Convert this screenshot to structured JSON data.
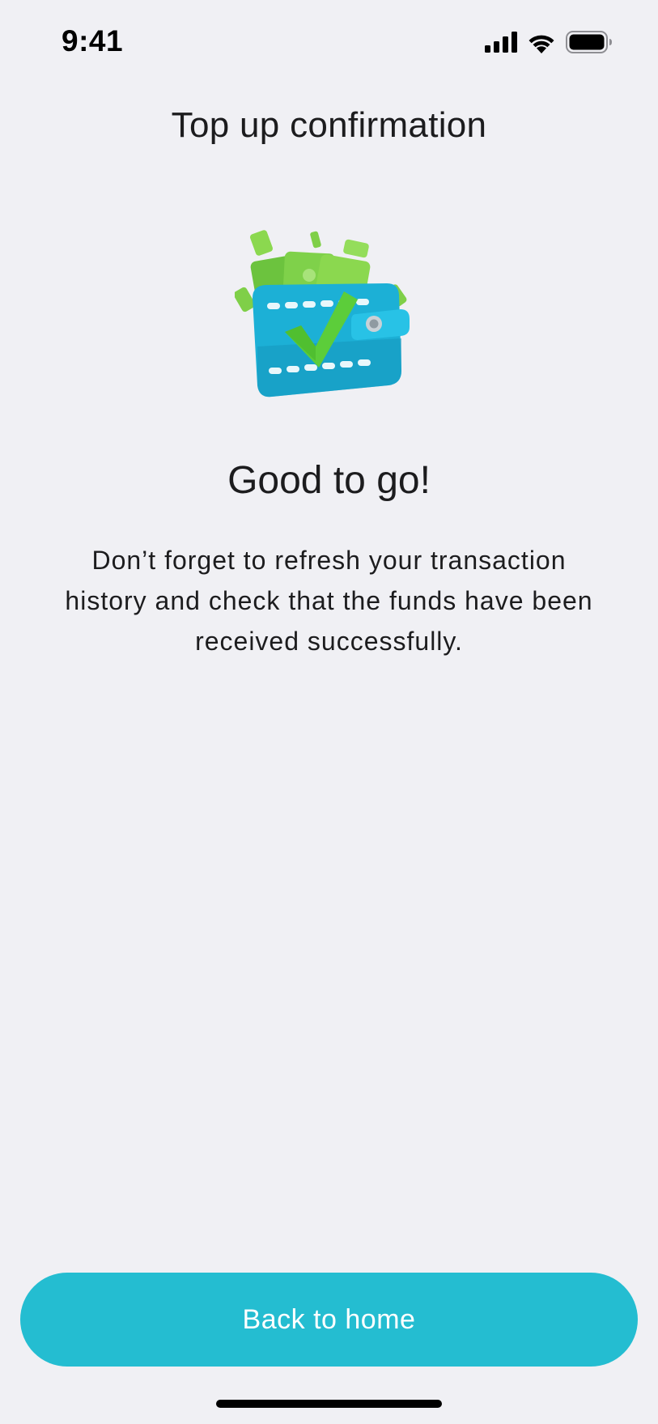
{
  "status_bar": {
    "time": "9:41",
    "icons": [
      "cellular-signal-icon",
      "wifi-icon",
      "battery-icon"
    ]
  },
  "header": {
    "title": "Top up confirmation"
  },
  "illustration": {
    "icon": "wallet-money-check-icon"
  },
  "content": {
    "headline": "Good to go!",
    "message": "Don’t forget to refresh your transaction history and check that the funds have been received successfully."
  },
  "footer": {
    "button_label": "Back to home"
  },
  "colors": {
    "background": "#f0f0f4",
    "accent": "#24bdd1",
    "wallet": "#1fb4d8",
    "money": "#7fd14a",
    "check": "#5ccd3a"
  }
}
